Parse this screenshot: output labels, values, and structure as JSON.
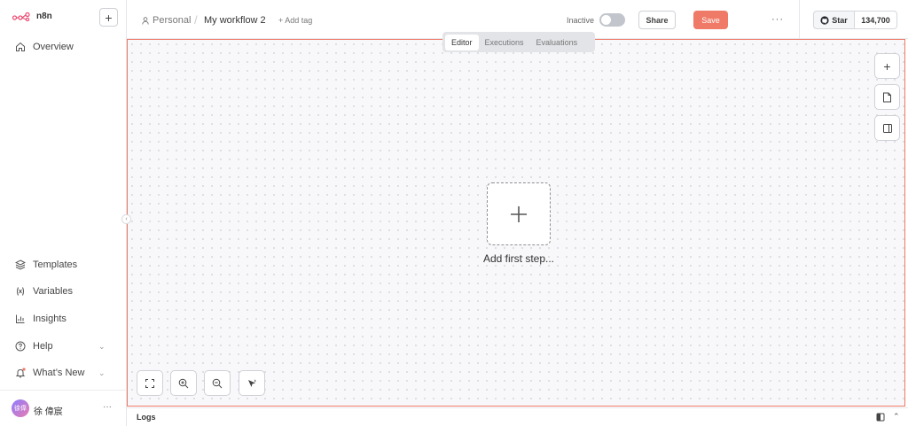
{
  "app": {
    "brand": "n8n",
    "accent_color": "#ee7a67"
  },
  "sidebar": {
    "new_button_icon": "plus-icon",
    "top_items": [
      {
        "label": "Overview",
        "icon": "home-icon"
      }
    ],
    "bottom_items": [
      {
        "label": "Templates",
        "icon": "templates-icon"
      },
      {
        "label": "Variables",
        "icon": "variables-icon"
      },
      {
        "label": "Insights",
        "icon": "insights-icon"
      },
      {
        "label": "Help",
        "icon": "help-icon",
        "expandable": true
      },
      {
        "label": "What’s New",
        "icon": "bell-icon",
        "expandable": true,
        "has_dot": true
      }
    ],
    "user": {
      "avatar_text": "徐偉",
      "name": "徐 偉宸"
    }
  },
  "header": {
    "owner": "Personal",
    "separator": "/",
    "workflow_name": "My workflow 2",
    "add_tag": "+ Add tag",
    "status": "Inactive",
    "active": false,
    "share_label": "Share",
    "save_label": "Save",
    "more_label": "···",
    "github": {
      "star_label": "Star",
      "count": "134,700"
    }
  },
  "canvas": {
    "tabs": [
      {
        "label": "Editor",
        "active": true
      },
      {
        "label": "Executions",
        "active": false
      },
      {
        "label": "Evaluations",
        "active": false
      }
    ],
    "right_tools": [
      "plus-icon",
      "sticky-note-icon",
      "side-panel-icon"
    ],
    "add_first_step": "Add first step...",
    "bottom_tools": [
      "fit-view-icon",
      "zoom-in-icon",
      "zoom-out-icon",
      "ai-cursor-icon"
    ]
  },
  "logs": {
    "label": "Logs"
  }
}
